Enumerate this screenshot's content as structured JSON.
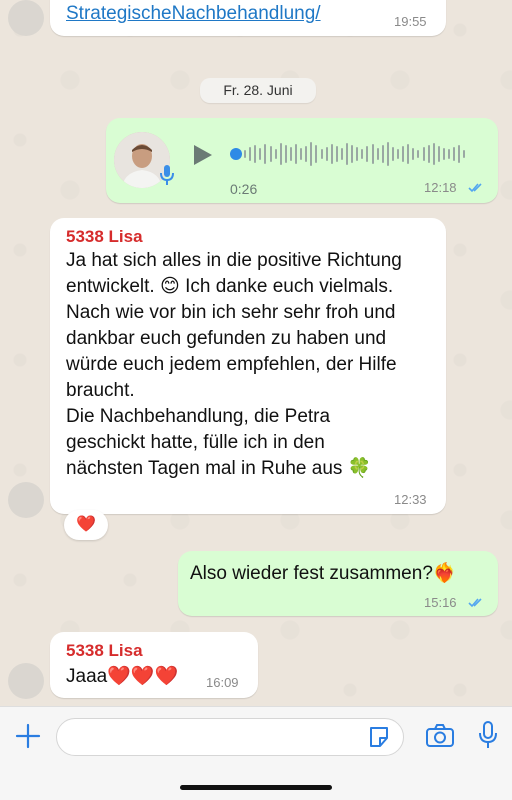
{
  "messages": {
    "top_link": {
      "text": "StrategischeNachbehandlung/",
      "time": "19:55"
    },
    "date_separator": "Fr. 28. Juni",
    "voice": {
      "duration": "0:26",
      "time": "12:18",
      "status": "read"
    },
    "lisa_long": {
      "sender": "5338 Lisa",
      "text": "Ja hat sich alles in die positive Richtung\nentwickelt. 😊 Ich danke euch vielmals.\nNach wie vor bin ich sehr sehr froh und\ndankbar euch gefunden zu haben und\nwürde euch jedem empfehlen, der Hilfe\nbraucht.\nDie Nachbehandlung, die Petra\ngeschickt hatte, fülle ich in den\nnächsten Tagen mal in Ruhe aus 🍀",
      "time": "12:33",
      "reaction": "❤️"
    },
    "out_question": {
      "text": "Also wieder fest zusammen?❤️‍🔥",
      "time": "15:16",
      "status": "read"
    },
    "lisa_short": {
      "sender": "5338 Lisa",
      "text": "Jaaa❤️❤️❤️",
      "time": "16:09"
    }
  },
  "composer": {
    "placeholder": ""
  },
  "colors": {
    "outgoing_bubble": "#d9fdd3",
    "incoming_bubble": "#ffffff",
    "accent": "#1f78c6",
    "sender": "#d62c2c",
    "read_ticks": "#53a6f0"
  }
}
